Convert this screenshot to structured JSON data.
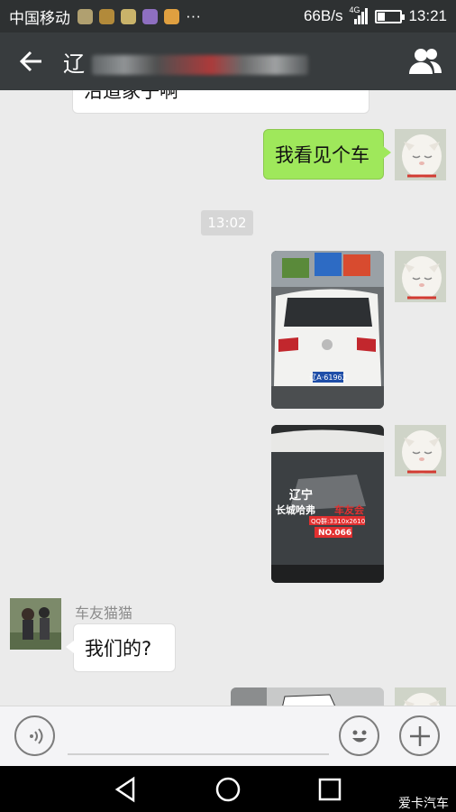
{
  "status_bar": {
    "carrier": "中国移动",
    "speed": "66B/s",
    "network": "4G",
    "time": "13:21"
  },
  "header": {
    "title": "辽",
    "back_icon": "arrow-left-icon",
    "members_icon": "group-icon"
  },
  "messages": {
    "top_partial_text": "沿道家子啊",
    "sent_text": "我看见个车",
    "timestamp": "13:02",
    "sender_name": "车友猫猫",
    "received_text": "我们的?"
  },
  "sticker_text": {
    "line1": "辽宁",
    "line2": "长城哈弗",
    "line3": "车友会",
    "phone": "QQ群:3310x2610",
    "number": "NO.066"
  },
  "plate_text": "辽A·61962",
  "input": {
    "voice_icon": "voice-icon",
    "emoji_icon": "emoji-icon",
    "plus_icon": "plus-icon"
  },
  "navigation": {
    "back": "nav-back-icon",
    "home": "nav-home-icon",
    "recent": "nav-recent-icon"
  },
  "watermark": "爱卡汽车",
  "colors": {
    "chat_background": "#ebebeb",
    "sent_bubble": "#9fe85b",
    "title_bar": "#383c3e"
  }
}
